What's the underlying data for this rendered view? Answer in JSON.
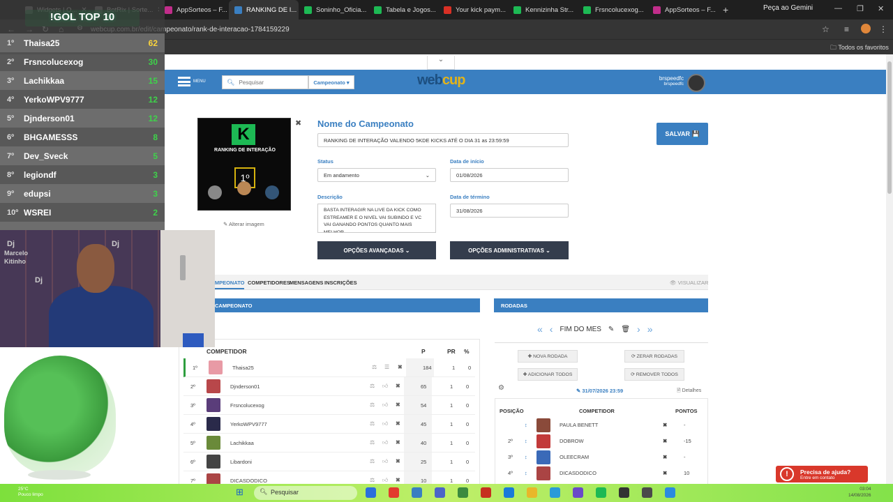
{
  "browser": {
    "tabs": [
      {
        "label": "Widgets | O...",
        "color": "#777"
      },
      {
        "label": "BotRix | Sorte...",
        "color": "#777"
      },
      {
        "label": "AppSorteos – F...",
        "color": "#c12d8a"
      },
      {
        "label": "RANKING DE I...",
        "color": "#3a7fc1"
      },
      {
        "label": "Soninho_Oficia...",
        "color": "#1db954"
      },
      {
        "label": "Tabela e Jogos...",
        "color": "#1db954"
      },
      {
        "label": "Your kick paym...",
        "color": "#d93025"
      },
      {
        "label": "Kennizinha Str...",
        "color": "#1db954"
      },
      {
        "label": "Frsncolucexog...",
        "color": "#1db954"
      },
      {
        "label": "AppSorteos – F...",
        "color": "#c12d8a"
      }
    ],
    "gemini_label": "Peça ao Gemini",
    "url": "webcup.com.br/edit/campeonato/rank-de-interacao-1784159229",
    "bookmarks_label": "Todos os favoritos"
  },
  "header": {
    "menu_label": "MENU",
    "search_placeholder": "Pesquisar",
    "campeonato_dropdown": "Campeonato ▾",
    "logo_web": "web",
    "logo_cup": "cup",
    "username": "brspeedfc",
    "username_sub": "brspeedfc"
  },
  "form": {
    "image_title": "RANKING DE INTERAÇÃO",
    "image_place": "1º",
    "alter_image": "✎ Alterar imagem",
    "title": "Nome do Campeonato",
    "name_value": "RANKING DE INTERAÇÃO VALENDO 5KDE KICKS ATÉ O DIA 31 as 23:59:59",
    "status_label": "Status",
    "status_value": "Em andamento",
    "start_label": "Data de início",
    "start_value": "01/08/2026",
    "desc_label": "Descrição",
    "desc_value": "BASTA INTERAGIR NA LIVE DA KICK COMO ESTREAMER E O NIVEL VAI SUBINDO E VC VAI GANANDO PONTOS QUANTO MAIS MELHOR....",
    "end_label": "Data de término",
    "end_value": "31/08/2026",
    "advanced_btn": "OPÇÕES AVANÇADAS ⌄",
    "admin_btn": "OPÇÕES ADMINISTRATIVAS ⌄",
    "save_btn": "SALVAR 💾"
  },
  "subtabs": {
    "campeonato": "CAMPEONATO",
    "competidores": "COMPETIDORES",
    "mensagens": "MENSAGENS",
    "inscricoes": "INSCRIÇÕES",
    "visualizar": "👁 VISUALIZAR"
  },
  "table": {
    "panel_title": "CAMPEONATO",
    "headers": {
      "competitor": "COMPETIDOR",
      "p": "P",
      "pr": "PR",
      "pct": "%"
    },
    "rows": [
      {
        "pos": "1º",
        "name": "Thaisa25",
        "p": "184",
        "pr": "1",
        "pct": "0",
        "color": "#e89aa5"
      },
      {
        "pos": "2º",
        "name": "Djnderson01",
        "p": "65",
        "pr": "1",
        "pct": "0",
        "color": "#b8474a"
      },
      {
        "pos": "3º",
        "name": "Frsncolucexog",
        "p": "54",
        "pr": "1",
        "pct": "0",
        "color": "#5a3d7a"
      },
      {
        "pos": "4º",
        "name": "YerkoWPV9777",
        "p": "45",
        "pr": "1",
        "pct": "0",
        "color": "#2a2a4a"
      },
      {
        "pos": "5º",
        "name": "Lachikkaa",
        "p": "40",
        "pr": "1",
        "pct": "0",
        "color": "#6a8a3a"
      },
      {
        "pos": "6º",
        "name": "Libardoni",
        "p": "25",
        "pr": "1",
        "pct": "0",
        "color": "#444"
      },
      {
        "pos": "7º",
        "name": "DICASDODICO",
        "p": "10",
        "pr": "1",
        "pct": "0",
        "color": "#a44"
      }
    ]
  },
  "rounds": {
    "panel_title": "RODADAS",
    "round_name": "FIM DO MES",
    "new_round": "✚ NOVA RODADA",
    "reset_rounds": "⟳ ZERAR RODADAS",
    "add_all": "✚ ADICIONAR TODOS",
    "remove_all": "⟳ REMOVER TODOS",
    "date": "31/07/2026 23:59",
    "details": "Detalhes",
    "headers": {
      "pos": "POSIÇÃO",
      "competitor": "COMPETIDOR",
      "points": "PONTOS"
    },
    "rows": [
      {
        "pos": "",
        "name": "PAULA BENETT",
        "points": "-",
        "color": "#8a4a3a"
      },
      {
        "pos": "2º",
        "name": "DOBROW",
        "points": "-15",
        "color": "#c23a3a"
      },
      {
        "pos": "3º",
        "name": "OLEECRAM",
        "points": "-",
        "color": "#3a6ab8"
      },
      {
        "pos": "4º",
        "name": "DICASDODICO",
        "points": "10",
        "color": "#a44"
      }
    ]
  },
  "help": {
    "title": "Precisa de ajuda?",
    "subtitle": "Entre em contato",
    "icon": "!"
  },
  "overlay": {
    "title": "!GOL TOP 10",
    "rows": [
      {
        "pos": "1º",
        "name": "Thaisa25",
        "pts": "62"
      },
      {
        "pos": "2º",
        "name": "Frsncolucexog",
        "pts": "30"
      },
      {
        "pos": "3º",
        "name": "Lachikkaa",
        "pts": "15"
      },
      {
        "pos": "4º",
        "name": "YerkoWPV9777",
        "pts": "12"
      },
      {
        "pos": "5º",
        "name": "Djnderson01",
        "pts": "12"
      },
      {
        "pos": "6º",
        "name": "BHGAMESSS",
        "pts": "8"
      },
      {
        "pos": "7º",
        "name": "Dev_Sveck",
        "pts": "5"
      },
      {
        "pos": "8º",
        "name": "legiondf",
        "pts": "3"
      },
      {
        "pos": "9º",
        "name": "edupsi",
        "pts": "3"
      },
      {
        "pos": "10º",
        "name": "WSREI",
        "pts": "2"
      }
    ]
  },
  "webcam_text": [
    "Dj",
    "Marcelo",
    "Kitinho"
  ],
  "taskbar": {
    "search": "Pesquisar",
    "weather_temp": "25°C",
    "weather_desc": "Pouco limpo",
    "time": "03:04",
    "date": "14/08/2026"
  }
}
